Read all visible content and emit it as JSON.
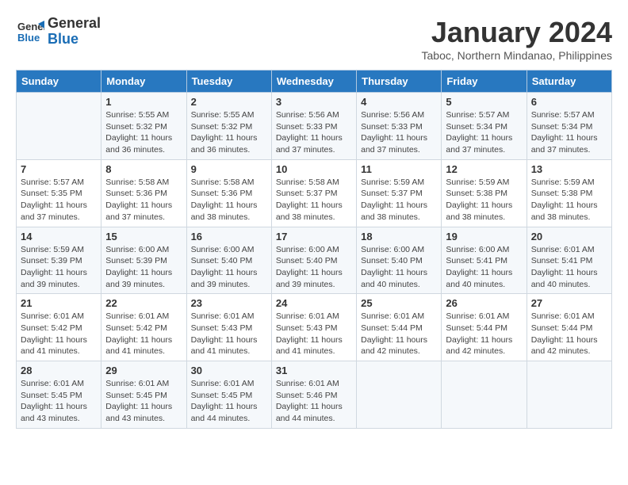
{
  "header": {
    "logo_line1": "General",
    "logo_line2": "Blue",
    "month": "January 2024",
    "location": "Taboc, Northern Mindanao, Philippines"
  },
  "weekdays": [
    "Sunday",
    "Monday",
    "Tuesday",
    "Wednesday",
    "Thursday",
    "Friday",
    "Saturday"
  ],
  "weeks": [
    [
      {
        "day": "",
        "info": ""
      },
      {
        "day": "1",
        "info": "Sunrise: 5:55 AM\nSunset: 5:32 PM\nDaylight: 11 hours\nand 36 minutes."
      },
      {
        "day": "2",
        "info": "Sunrise: 5:55 AM\nSunset: 5:32 PM\nDaylight: 11 hours\nand 36 minutes."
      },
      {
        "day": "3",
        "info": "Sunrise: 5:56 AM\nSunset: 5:33 PM\nDaylight: 11 hours\nand 37 minutes."
      },
      {
        "day": "4",
        "info": "Sunrise: 5:56 AM\nSunset: 5:33 PM\nDaylight: 11 hours\nand 37 minutes."
      },
      {
        "day": "5",
        "info": "Sunrise: 5:57 AM\nSunset: 5:34 PM\nDaylight: 11 hours\nand 37 minutes."
      },
      {
        "day": "6",
        "info": "Sunrise: 5:57 AM\nSunset: 5:34 PM\nDaylight: 11 hours\nand 37 minutes."
      }
    ],
    [
      {
        "day": "7",
        "info": "Sunrise: 5:57 AM\nSunset: 5:35 PM\nDaylight: 11 hours\nand 37 minutes."
      },
      {
        "day": "8",
        "info": "Sunrise: 5:58 AM\nSunset: 5:36 PM\nDaylight: 11 hours\nand 37 minutes."
      },
      {
        "day": "9",
        "info": "Sunrise: 5:58 AM\nSunset: 5:36 PM\nDaylight: 11 hours\nand 38 minutes."
      },
      {
        "day": "10",
        "info": "Sunrise: 5:58 AM\nSunset: 5:37 PM\nDaylight: 11 hours\nand 38 minutes."
      },
      {
        "day": "11",
        "info": "Sunrise: 5:59 AM\nSunset: 5:37 PM\nDaylight: 11 hours\nand 38 minutes."
      },
      {
        "day": "12",
        "info": "Sunrise: 5:59 AM\nSunset: 5:38 PM\nDaylight: 11 hours\nand 38 minutes."
      },
      {
        "day": "13",
        "info": "Sunrise: 5:59 AM\nSunset: 5:38 PM\nDaylight: 11 hours\nand 38 minutes."
      }
    ],
    [
      {
        "day": "14",
        "info": "Sunrise: 5:59 AM\nSunset: 5:39 PM\nDaylight: 11 hours\nand 39 minutes."
      },
      {
        "day": "15",
        "info": "Sunrise: 6:00 AM\nSunset: 5:39 PM\nDaylight: 11 hours\nand 39 minutes."
      },
      {
        "day": "16",
        "info": "Sunrise: 6:00 AM\nSunset: 5:40 PM\nDaylight: 11 hours\nand 39 minutes."
      },
      {
        "day": "17",
        "info": "Sunrise: 6:00 AM\nSunset: 5:40 PM\nDaylight: 11 hours\nand 39 minutes."
      },
      {
        "day": "18",
        "info": "Sunrise: 6:00 AM\nSunset: 5:40 PM\nDaylight: 11 hours\nand 40 minutes."
      },
      {
        "day": "19",
        "info": "Sunrise: 6:00 AM\nSunset: 5:41 PM\nDaylight: 11 hours\nand 40 minutes."
      },
      {
        "day": "20",
        "info": "Sunrise: 6:01 AM\nSunset: 5:41 PM\nDaylight: 11 hours\nand 40 minutes."
      }
    ],
    [
      {
        "day": "21",
        "info": "Sunrise: 6:01 AM\nSunset: 5:42 PM\nDaylight: 11 hours\nand 41 minutes."
      },
      {
        "day": "22",
        "info": "Sunrise: 6:01 AM\nSunset: 5:42 PM\nDaylight: 11 hours\nand 41 minutes."
      },
      {
        "day": "23",
        "info": "Sunrise: 6:01 AM\nSunset: 5:43 PM\nDaylight: 11 hours\nand 41 minutes."
      },
      {
        "day": "24",
        "info": "Sunrise: 6:01 AM\nSunset: 5:43 PM\nDaylight: 11 hours\nand 41 minutes."
      },
      {
        "day": "25",
        "info": "Sunrise: 6:01 AM\nSunset: 5:44 PM\nDaylight: 11 hours\nand 42 minutes."
      },
      {
        "day": "26",
        "info": "Sunrise: 6:01 AM\nSunset: 5:44 PM\nDaylight: 11 hours\nand 42 minutes."
      },
      {
        "day": "27",
        "info": "Sunrise: 6:01 AM\nSunset: 5:44 PM\nDaylight: 11 hours\nand 42 minutes."
      }
    ],
    [
      {
        "day": "28",
        "info": "Sunrise: 6:01 AM\nSunset: 5:45 PM\nDaylight: 11 hours\nand 43 minutes."
      },
      {
        "day": "29",
        "info": "Sunrise: 6:01 AM\nSunset: 5:45 PM\nDaylight: 11 hours\nand 43 minutes."
      },
      {
        "day": "30",
        "info": "Sunrise: 6:01 AM\nSunset: 5:45 PM\nDaylight: 11 hours\nand 44 minutes."
      },
      {
        "day": "31",
        "info": "Sunrise: 6:01 AM\nSunset: 5:46 PM\nDaylight: 11 hours\nand 44 minutes."
      },
      {
        "day": "",
        "info": ""
      },
      {
        "day": "",
        "info": ""
      },
      {
        "day": "",
        "info": ""
      }
    ]
  ]
}
